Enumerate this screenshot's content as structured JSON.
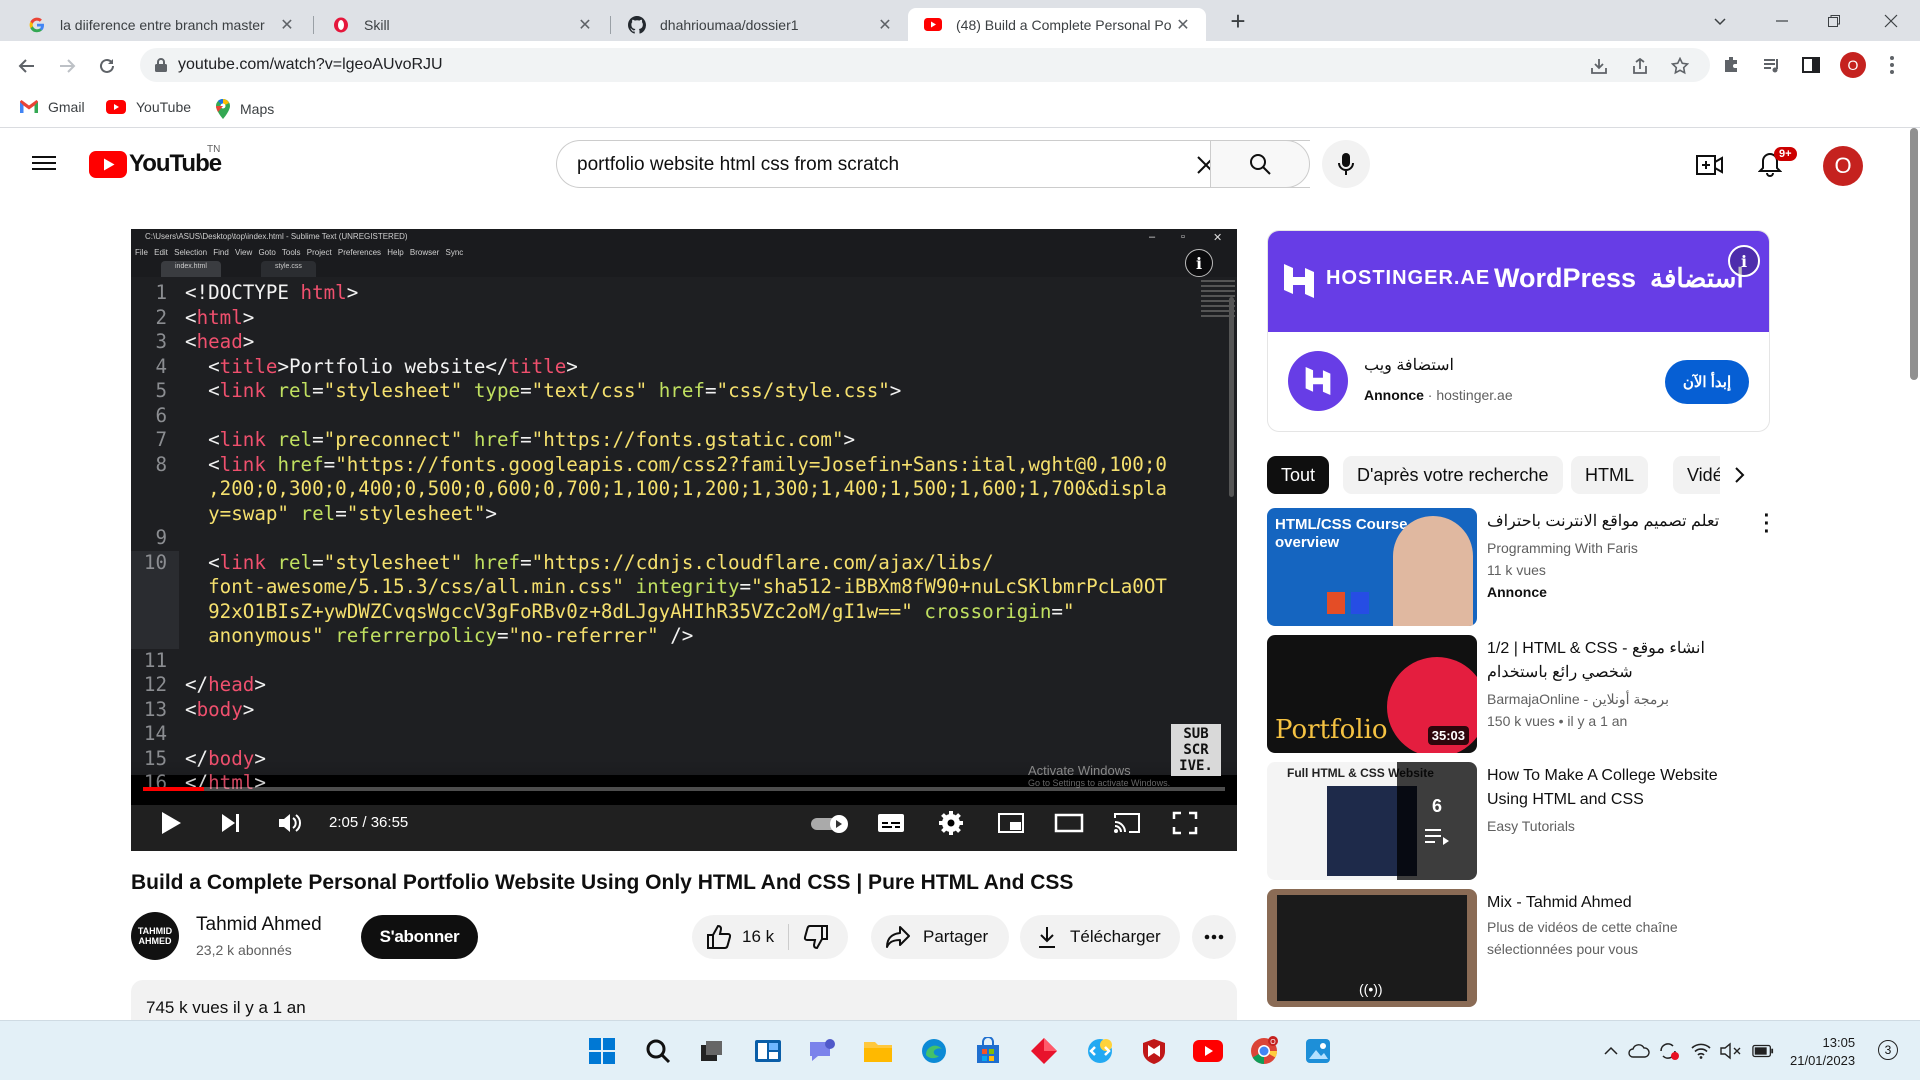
{
  "browser": {
    "tabs": [
      {
        "title": "la diiference entre branch master",
        "icon": "google-icon"
      },
      {
        "title": "Skill",
        "icon": "opera-icon"
      },
      {
        "title": "dhahrioumaa/dossier1",
        "icon": "github-icon"
      },
      {
        "title": "(48) Build a Complete Personal Po",
        "icon": "youtube-icon"
      }
    ],
    "url": "youtube.com/watch?v=lgeoAUvoRJU",
    "profile_initial": "O",
    "bookmarks": [
      {
        "label": "Gmail",
        "icon": "gmail-icon"
      },
      {
        "label": "YouTube",
        "icon": "youtube-icon"
      },
      {
        "label": "Maps",
        "icon": "maps-icon"
      }
    ]
  },
  "youtube": {
    "logo_text": "YouTube",
    "logo_region": "TN",
    "search_query": "portfolio website html css from scratch",
    "notification_count": "9+",
    "avatar_initial": "O"
  },
  "player": {
    "sublime": {
      "window_title": "C:\\Users\\ASUS\\Desktop\\top\\index.html - Sublime Text (UNREGISTERED)",
      "menu": "File Edit Selection Find View Goto Tools Project Preferences Help Browser Sync",
      "tabs": [
        "index.html",
        "style.css"
      ]
    },
    "code_lines": [
      {
        "n": "1",
        "html": "<span class='t-pun'>&lt;!DOCTYPE </span><span class='t-tag'>html</span><span class='t-pun'>&gt;</span>"
      },
      {
        "n": "2",
        "html": "<span class='t-pun'>&lt;</span><span class='t-tag'>html</span><span class='t-pun'>&gt;</span>"
      },
      {
        "n": "3",
        "html": "<span class='t-pun'>&lt;</span><span class='t-tag'>head</span><span class='t-pun'>&gt;</span>"
      },
      {
        "n": "4",
        "html": "  <span class='t-pun'>&lt;</span><span class='t-tag'>title</span><span class='t-pun'>&gt;Portfolio website&lt;/</span><span class='t-tag'>title</span><span class='t-pun'>&gt;</span>"
      },
      {
        "n": "5",
        "html": "  <span class='t-pun'>&lt;</span><span class='t-tag'>link</span> <span class='t-att'>rel</span>=<span class='t-str'>\"stylesheet\"</span> <span class='t-att'>type</span>=<span class='t-str'>\"text/css\"</span> <span class='t-att'>href</span>=<span class='t-str'>\"css/style.css\"</span><span class='t-pun'>&gt;</span>"
      },
      {
        "n": "6",
        "html": ""
      },
      {
        "n": "7",
        "html": "  <span class='t-pun'>&lt;</span><span class='t-tag'>link</span> <span class='t-att'>rel</span>=<span class='t-str'>\"preconnect\"</span> <span class='t-att'>href</span>=<span class='t-str'>\"https://fonts.gstatic.com\"</span><span class='t-pun'>&gt;</span>"
      },
      {
        "n": "8",
        "html": "  <span class='t-pun'>&lt;</span><span class='t-tag'>link</span> <span class='t-att'>href</span>=<span class='t-str'>\"https://fonts.googleapis.com/css2?family=Josefin+Sans:ital,wght@0,100;0</span>"
      },
      {
        "n": "",
        "html": "  <span class='t-str'>,200;0,300;0,400;0,500;0,600;0,700;1,100;1,200;1,300;1,400;1,500;1,600;1,700&amp;displa</span>"
      },
      {
        "n": "",
        "html": "  <span class='t-str'>y=swap\"</span> <span class='t-att'>rel</span>=<span class='t-str'>\"stylesheet\"</span><span class='t-pun'>&gt;</span>"
      },
      {
        "n": "9",
        "html": ""
      },
      {
        "n": "10",
        "html": "  <span class='t-pun'>&lt;</span><span class='t-tag'>link</span> <span class='t-att'>rel</span>=<span class='t-str'>\"stylesheet\"</span> <span class='t-att'>href</span>=<span class='t-str'>\"https://cdnjs.cloudflare.com/ajax/libs/</span>"
      },
      {
        "n": "",
        "html": "  <span class='t-str'>font-awesome/5.15.3/css/all.min.css\"</span> <span class='t-att'>integrity</span>=<span class='t-str'>\"sha512-iBBXm8fW90+nuLcSKlbmrPcLa0OT</span>"
      },
      {
        "n": "",
        "html": "  <span class='t-str'>92xO1BIsZ+ywDWZCvqsWgccV3gFoRBv0z+8dLJgyAHIhR35VZc2oM/gI1w==\"</span> <span class='t-att'>crossorigin</span>=<span class='t-str'>\"</span>"
      },
      {
        "n": "",
        "html": "  <span class='t-str'>anonymous\"</span> <span class='t-att'>referrerpolicy</span>=<span class='t-str'>\"no-referrer\"</span> <span class='t-pun'>/&gt;</span>"
      },
      {
        "n": "11",
        "html": ""
      },
      {
        "n": "12",
        "html": "<span class='t-pun'>&lt;/</span><span class='t-tag'>head</span><span class='t-pun'>&gt;</span>"
      },
      {
        "n": "13",
        "html": "<span class='t-pun'>&lt;</span><span class='t-tag'>body</span><span class='t-pun'>&gt;</span>"
      },
      {
        "n": "14",
        "html": ""
      },
      {
        "n": "15",
        "html": "<span class='t-pun'>&lt;/</span><span class='t-tag'>body</span><span class='t-pun'>&gt;</span>"
      },
      {
        "n": "16",
        "html": "<span class='t-pun'>&lt;/</span><span class='t-tag'>html</span><span class='t-pun'>&gt;</span>"
      }
    ],
    "subscribe_watermark": "SUB\nSCR\nIVE.",
    "activate_windows": "Activate Windows",
    "activate_windows_sub": "Go to Settings to activate Windows.",
    "time_current": "2:05",
    "time_total": "36:55",
    "progress_fraction": 0.0565
  },
  "video": {
    "title": "Build a Complete Personal Portfolio Website Using Only HTML And CSS | Pure HTML And CSS",
    "channel_name": "Tahmid Ahmed",
    "channel_avatar_text": "TAHMID AHMED",
    "channel_subs": "23,2 k abonnés",
    "subscribe_label": "S'abonner",
    "likes": "16 k",
    "share_label": "Partager",
    "download_label": "Télécharger",
    "views_date": "745 k vues  il y a 1 an"
  },
  "ad": {
    "brand": "HOSTINGER.AE",
    "product": "WordPress",
    "arabic_tag": "استضافة",
    "name": "استضافة ويب",
    "label": "Annonce",
    "domain": "hostinger.ae",
    "cta": "إبدأ الآن"
  },
  "chips": [
    "Tout",
    "D'après votre recherche",
    "HTML",
    "Vidéos"
  ],
  "recommendations": [
    {
      "title": "تعلم تصميم مواقع الانترنت باحتراف",
      "channel": "Programming With Faris",
      "line2": "11 k vues",
      "line3": "Annonce",
      "duration": "",
      "thumb_text": "HTML/CSS Course overview"
    },
    {
      "title": "1/2 | HTML & CSS - انشاء موقع شخصي رائع باستخدام",
      "channel": "BarmajaOnline - برمجة أونلاين",
      "line2": "150 k vues  •  il y a 1 an",
      "line3": "",
      "duration": "35:03",
      "thumb_text": "Portfolio"
    },
    {
      "title": "How To Make A College Website Using HTML and CSS",
      "channel": "Easy Tutorials",
      "line2": "",
      "line3": "",
      "duration": "",
      "thumb_text": "Full HTML & CSS Website",
      "playlist_count": "6"
    },
    {
      "title": "Mix - Tahmid Ahmed",
      "channel": "Plus de vidéos de cette chaîne",
      "line2": "sélectionnées pour vous",
      "line3": "",
      "duration": "",
      "thumb_text": ""
    }
  ],
  "taskbar": {
    "time": "13:05",
    "date": "21/01/2023",
    "notification_count": "3"
  },
  "colors": {
    "youtube_red": "#ff0000",
    "hostinger_purple": "#673de6",
    "cta_blue": "#065fd4",
    "avatar_red": "#c5221f"
  }
}
